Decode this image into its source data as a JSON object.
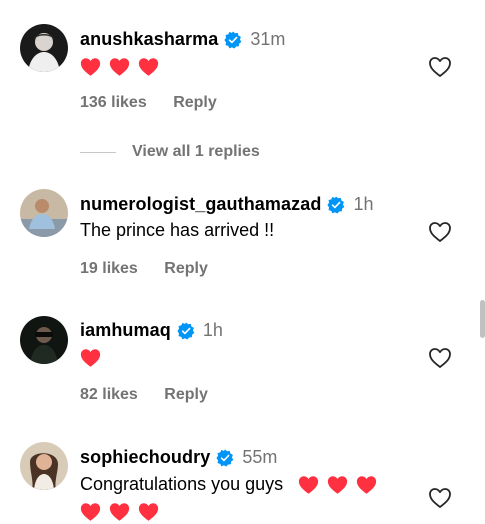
{
  "comments": [
    {
      "username": "anushkasharma",
      "time": "31m",
      "text": "",
      "hearts": 3,
      "likes": "136 likes",
      "reply": "Reply",
      "view_replies": "View all 1 replies"
    },
    {
      "username": "numerologist_gauthamazad",
      "time": "1h",
      "text": "The prince has arrived !!",
      "likes": "19 likes",
      "reply": "Reply"
    },
    {
      "username": "iamhumaq",
      "time": "1h",
      "text": "",
      "hearts": 1,
      "likes": "82 likes",
      "reply": "Reply"
    },
    {
      "username": "sophiechoudry",
      "time": "55m",
      "text": "Congratulations you guys",
      "hearts": 3,
      "hearts_line2": 3
    }
  ],
  "colors": {
    "heart_red": "#ff3040",
    "verified_blue": "#0095f6",
    "secondary_text": "#737373"
  },
  "icons": {
    "verified": "verified-badge-icon",
    "like": "heart-outline-icon",
    "emoji": "red-heart-emoji"
  }
}
